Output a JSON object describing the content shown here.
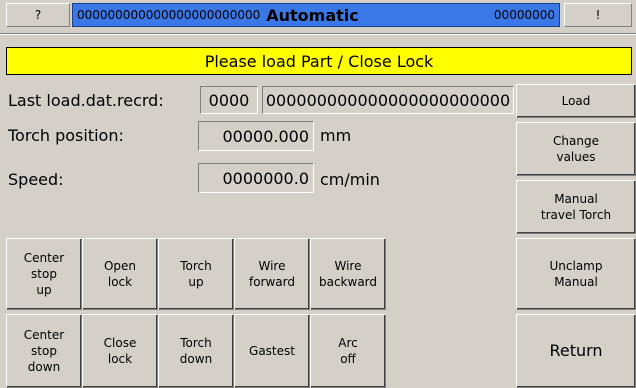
{
  "topbar": {
    "help_label": "?",
    "counter_left": "000000000000000000000000",
    "mode": "Automatic",
    "counter_right": "00000000",
    "alert_label": "!"
  },
  "banner": "Please load Part / Close Lock",
  "info": {
    "last_load_label": "Last load.dat.recrd:",
    "last_load_number": "0000",
    "last_load_record": "000000000000000000000000",
    "torch_label": "Torch position:",
    "torch_value": "00000.000",
    "torch_unit": "mm",
    "speed_label": "Speed:",
    "speed_value": "0000000.0",
    "speed_unit": "cm/min"
  },
  "side": {
    "load": "Load",
    "change": "Change\nvalues",
    "manual_travel": "Manual\ntravel Torch",
    "unclamp": "Unclamp\nManual",
    "return": "Return"
  },
  "grid": {
    "center_stop_up": "Center\nstop\nup",
    "open_lock": "Open\nlock",
    "torch_up": "Torch\nup",
    "wire_forward": "Wire\nforward",
    "wire_backward": "Wire\nbackward",
    "center_stop_down": "Center\nstop\ndown",
    "close_lock": "Close\nlock",
    "torch_down": "Torch\ndown",
    "gastest": "Gastest",
    "arc_off": "Arc\noff"
  }
}
